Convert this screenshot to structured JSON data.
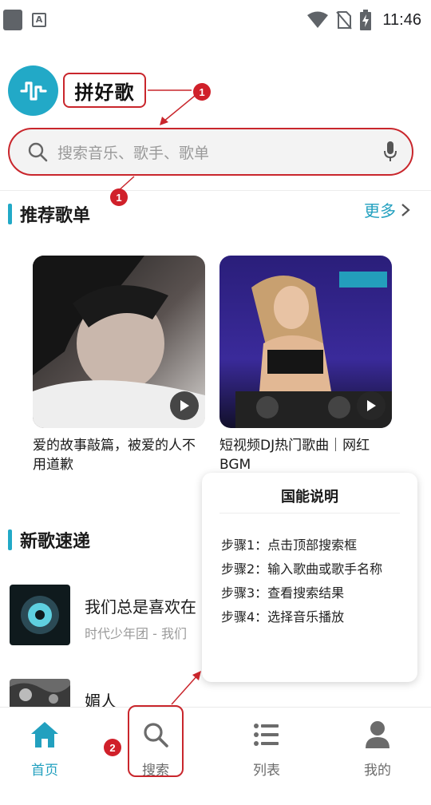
{
  "status_bar": {
    "time": "11:46",
    "a_icon": "A"
  },
  "header": {
    "app_name": "拼好歌"
  },
  "search": {
    "placeholder": "搜索音乐、歌手、歌单"
  },
  "recommended": {
    "title": "推荐歌单",
    "more_label": "更多",
    "playlists": [
      {
        "title": "爱的故事敲篇，被爱的人不用道歉"
      },
      {
        "title": "短视频DJ热门歌曲｜网红BGM"
      }
    ]
  },
  "new_songs": {
    "title": "新歌速递",
    "items": [
      {
        "title": "我们总是喜欢在",
        "subtitle": "时代少年团 - 我们"
      },
      {
        "title": "媚人",
        "subtitle": ""
      }
    ]
  },
  "popup": {
    "title": "国能说明",
    "steps": [
      "步骤1：点击顶部搜索框",
      "步骤2：输入歌曲或歌手名称",
      "步骤3：查看搜索结果",
      "步骤4：选择音乐播放"
    ]
  },
  "annotations": {
    "badge_1": "1",
    "badge_2": "2"
  },
  "bottom_nav": {
    "items": [
      {
        "label": "首页",
        "icon": "home-icon",
        "active": true
      },
      {
        "label": "搜索",
        "icon": "search-icon",
        "active": false
      },
      {
        "label": "列表",
        "icon": "list-icon",
        "active": false
      },
      {
        "label": "我的",
        "icon": "person-icon",
        "active": false
      }
    ]
  },
  "colors": {
    "accent": "#22a9c7",
    "annotation_red": "#c9262c"
  }
}
